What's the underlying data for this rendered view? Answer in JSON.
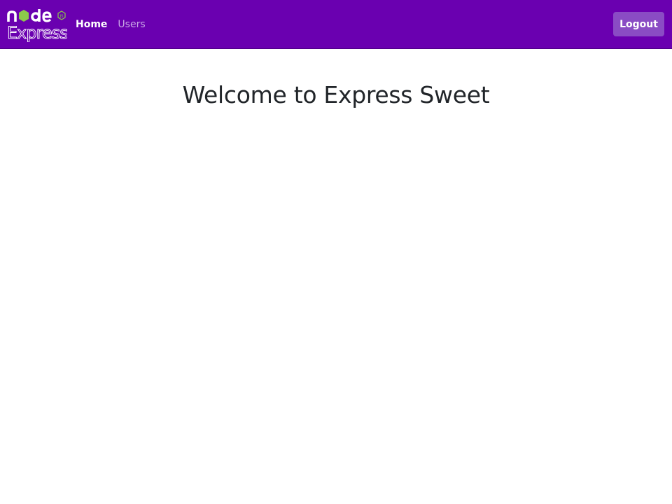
{
  "brand": {
    "node_text": "node",
    "js_badge": "JS",
    "express_text": "Express",
    "colors": {
      "hexagon": "#8cc84b",
      "text": "#ffffff"
    }
  },
  "navbar": {
    "background": "#6a00b0",
    "links": [
      {
        "label": "Home",
        "active": true
      },
      {
        "label": "Users",
        "active": false
      }
    ],
    "logout_label": "Logout"
  },
  "main": {
    "title": "Welcome to Express Sweet"
  }
}
